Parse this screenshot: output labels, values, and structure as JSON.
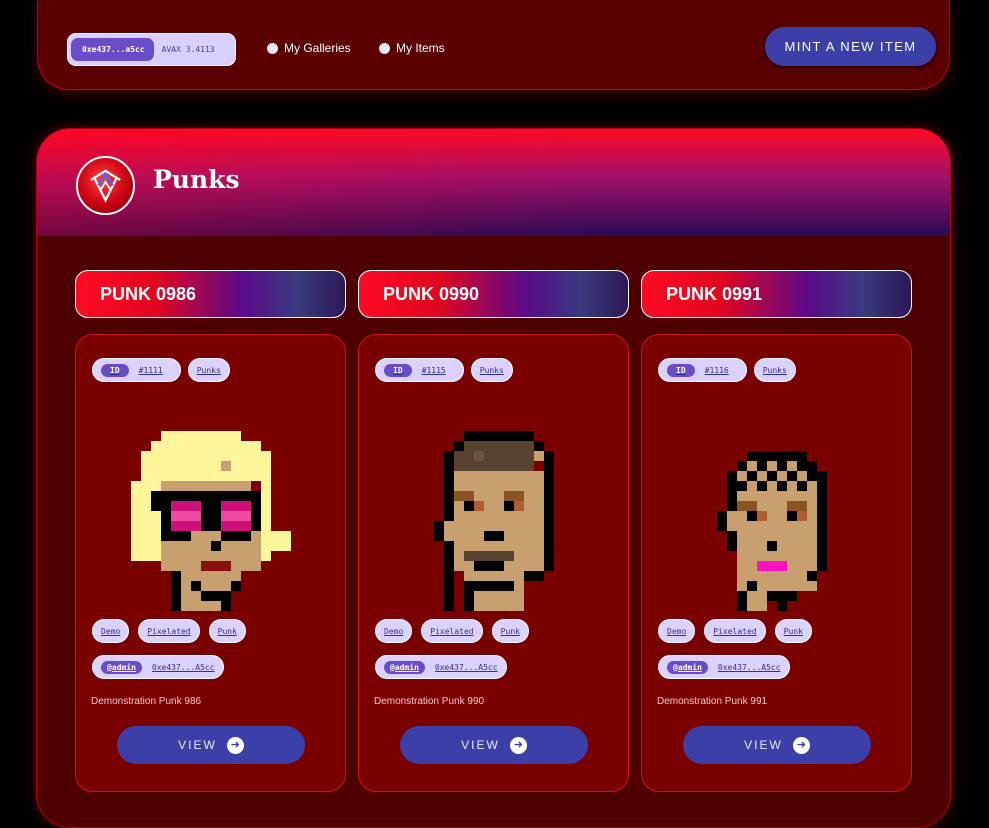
{
  "header": {
    "wallet_address": "0xe437...a5cc",
    "wallet_balance": "AVAX 3.4113",
    "nav": [
      {
        "label": "My Galleries"
      },
      {
        "label": "My Items"
      }
    ],
    "mint_label": "MINT A NEW ITEM"
  },
  "gallery": {
    "title": "Punks",
    "logo_icon": "gallery-logo"
  },
  "items": [
    {
      "title": "PUNK 0986",
      "id_label": "ID",
      "id_value": "#1111",
      "collection_tag": "Punks",
      "tags": [
        "Demo",
        "Pixelated",
        "Punk"
      ],
      "owner_handle": "@admin",
      "owner_address": "0xe437...A5cc",
      "description": "Demonstration Punk 986",
      "view_label": "VIEW"
    },
    {
      "title": "PUNK 0990",
      "id_label": "ID",
      "id_value": "#1115",
      "collection_tag": "Punks",
      "tags": [
        "Demo",
        "Pixelated",
        "Punk"
      ],
      "owner_handle": "@admin",
      "owner_address": "0xe437...A5cc",
      "description": "Demonstration Punk 990",
      "view_label": "VIEW"
    },
    {
      "title": "PUNK 0991",
      "id_label": "ID",
      "id_value": "#1116",
      "collection_tag": "Punks",
      "tags": [
        "Demo",
        "Pixelated",
        "Punk"
      ],
      "owner_handle": "@admin",
      "owner_address": "0xe437...A5cc",
      "description": "Demonstration Punk 991",
      "view_label": "VIEW"
    }
  ],
  "colors": {
    "accent": "#3c3fa8",
    "panel": "#5a0000",
    "brand_red": "#ff0a24"
  }
}
